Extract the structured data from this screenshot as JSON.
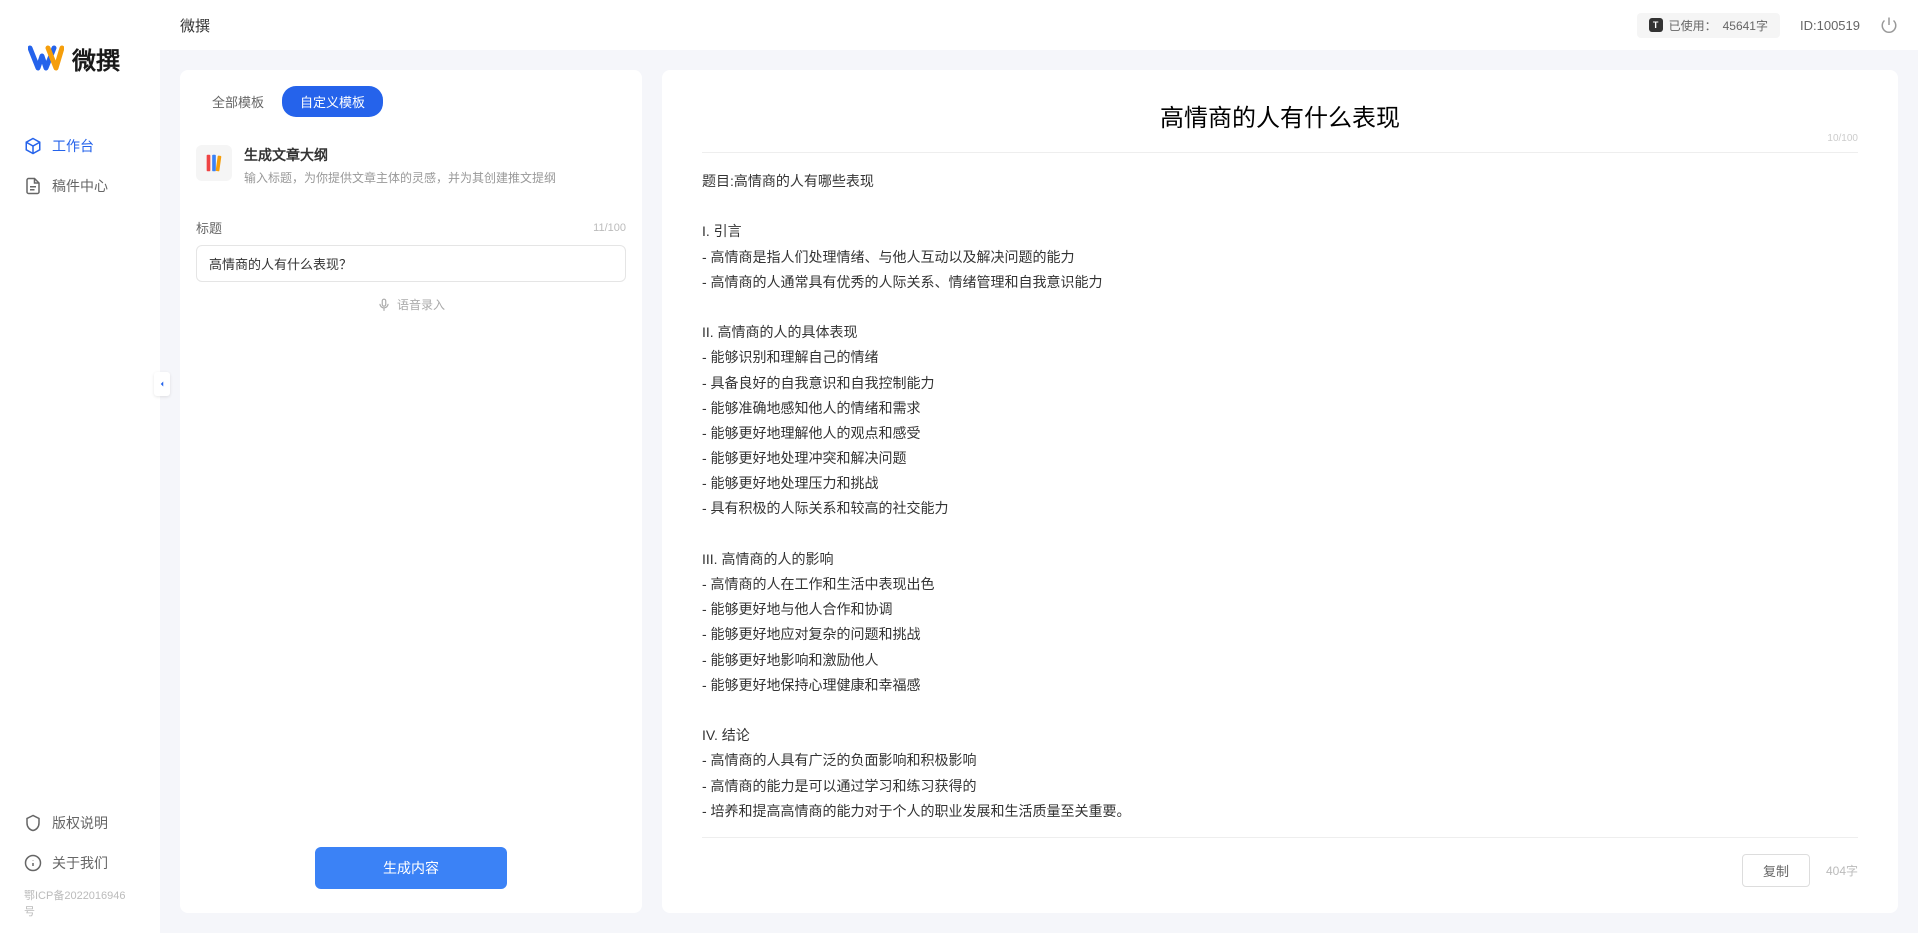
{
  "app": {
    "logo_text": "微撰",
    "header_title": "微撰"
  },
  "sidebar": {
    "nav": [
      {
        "label": "工作台",
        "icon": "cube-icon"
      },
      {
        "label": "稿件中心",
        "icon": "document-icon"
      }
    ],
    "bottom_nav": [
      {
        "label": "版权说明",
        "icon": "shield-icon"
      },
      {
        "label": "关于我们",
        "icon": "info-icon"
      }
    ],
    "icp": "鄂ICP备2022016946号"
  },
  "header": {
    "usage_label": "已使用：",
    "usage_value": "45641字",
    "user_id_label": "ID:",
    "user_id": "100519"
  },
  "left_panel": {
    "tabs": [
      {
        "label": "全部模板"
      },
      {
        "label": "自定义模板"
      }
    ],
    "template": {
      "title": "生成文章大纲",
      "desc": "输入标题，为你提供文章主体的灵感，并为其创建推文提纲"
    },
    "form": {
      "title_label": "标题",
      "title_value": "高情商的人有什么表现？",
      "title_count": "11/100",
      "voice_input_label": "语音录入"
    },
    "generate_btn": "生成内容"
  },
  "output": {
    "title": "高情商的人有什么表现",
    "title_count": "10/100",
    "content": "题目:高情商的人有哪些表现\n\nI. 引言\n- 高情商是指人们处理情绪、与他人互动以及解决问题的能力\n- 高情商的人通常具有优秀的人际关系、情绪管理和自我意识能力\n\nII. 高情商的人的具体表现\n- 能够识别和理解自己的情绪\n- 具备良好的自我意识和自我控制能力\n- 能够准确地感知他人的情绪和需求\n- 能够更好地理解他人的观点和感受\n- 能够更好地处理冲突和解决问题\n- 能够更好地处理压力和挑战\n- 具有积极的人际关系和较高的社交能力\n\nIII. 高情商的人的影响\n- 高情商的人在工作和生活中表现出色\n- 能够更好地与他人合作和协调\n- 能够更好地应对复杂的问题和挑战\n- 能够更好地影响和激励他人\n- 能够更好地保持心理健康和幸福感\n\nIV. 结论\n- 高情商的人具有广泛的负面影响和积极影响\n- 高情商的能力是可以通过学习和练习获得的\n- 培养和提高高情商的能力对于个人的职业发展和生活质量至关重要。",
    "copy_btn": "复制",
    "word_count": "404字"
  }
}
